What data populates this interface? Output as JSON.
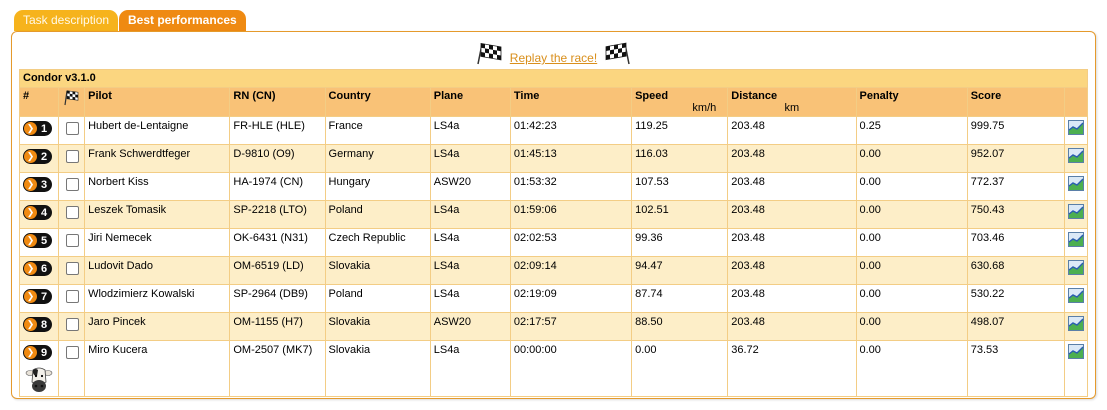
{
  "tabs": {
    "task_description": "Task description",
    "best_performances": "Best performances"
  },
  "replay": {
    "label": "Replay the race!"
  },
  "table": {
    "caption": "Condor v3.1.0",
    "headers": {
      "rank": "#",
      "pilot": "Pilot",
      "rn": "RN (CN)",
      "country": "Country",
      "plane": "Plane",
      "time": "Time",
      "speed": "Speed",
      "speed_unit": "km/h",
      "distance": "Distance",
      "distance_unit": "km",
      "penalty": "Penalty",
      "score": "Score"
    },
    "rows": [
      {
        "rank": "1",
        "pilot": "Hubert de-Lentaigne",
        "rn": "FR-HLE (HLE)",
        "country": "France",
        "plane": "LS4a",
        "time": "01:42:23",
        "speed": "119.25",
        "distance": "203.48",
        "penalty": "0.25",
        "score": "999.75"
      },
      {
        "rank": "2",
        "pilot": "Frank Schwerdtfeger",
        "rn": "D-9810 (O9)",
        "country": "Germany",
        "plane": "LS4a",
        "time": "01:45:13",
        "speed": "116.03",
        "distance": "203.48",
        "penalty": "0.00",
        "score": "952.07"
      },
      {
        "rank": "3",
        "pilot": "Norbert Kiss",
        "rn": "HA-1974 (CN)",
        "country": "Hungary",
        "plane": "ASW20",
        "time": "01:53:32",
        "speed": "107.53",
        "distance": "203.48",
        "penalty": "0.00",
        "score": "772.37"
      },
      {
        "rank": "4",
        "pilot": "Leszek Tomasik",
        "rn": "SP-2218 (LTO)",
        "country": "Poland",
        "plane": "LS4a",
        "time": "01:59:06",
        "speed": "102.51",
        "distance": "203.48",
        "penalty": "0.00",
        "score": "750.43"
      },
      {
        "rank": "5",
        "pilot": "Jiri Nemecek",
        "rn": "OK-6431 (N31)",
        "country": "Czech Republic",
        "plane": "LS4a",
        "time": "02:02:53",
        "speed": "99.36",
        "distance": "203.48",
        "penalty": "0.00",
        "score": "703.46"
      },
      {
        "rank": "6",
        "pilot": "Ludovit Dado",
        "rn": "OM-6519 (LD)",
        "country": "Slovakia",
        "plane": "LS4a",
        "time": "02:09:14",
        "speed": "94.47",
        "distance": "203.48",
        "penalty": "0.00",
        "score": "630.68"
      },
      {
        "rank": "7",
        "pilot": "Wlodzimierz Kowalski",
        "rn": "SP-2964 (DB9)",
        "country": "Poland",
        "plane": "LS4a",
        "time": "02:19:09",
        "speed": "87.74",
        "distance": "203.48",
        "penalty": "0.00",
        "score": "530.22"
      },
      {
        "rank": "8",
        "pilot": "Jaro Pincek",
        "rn": "OM-1155 (H7)",
        "country": "Slovakia",
        "plane": "ASW20",
        "time": "02:17:57",
        "speed": "88.50",
        "distance": "203.48",
        "penalty": "0.00",
        "score": "498.07"
      },
      {
        "rank": "9",
        "pilot": "Miro Kucera",
        "rn": "OM-2507 (MK7)",
        "country": "Slovakia",
        "plane": "LS4a",
        "time": "00:00:00",
        "speed": "0.00",
        "distance": "36.72",
        "penalty": "0.00",
        "score": "73.53"
      }
    ]
  },
  "colors": {
    "tab_active": "#ef8a12",
    "tab_inactive": "#f6b31c",
    "header_bg": "#f9c277",
    "caption_bg": "#fbd680",
    "row_alt_bg": "#fdeec8",
    "link": "#d98f1c"
  },
  "icons": {
    "flag": "checkered-flag-icon",
    "rank_arrow": "orange-arrow-icon",
    "chart": "chart-icon",
    "cow": "cow-icon"
  }
}
